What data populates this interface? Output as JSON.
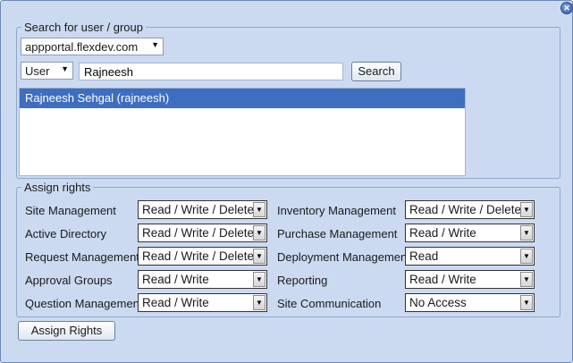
{
  "search": {
    "legend": "Search for user / group",
    "domain": "appportal.flexdev.com",
    "type": "User",
    "query": "Rajneesh",
    "search_button": "Search",
    "results": [
      "Rajneesh Sehgal (rajneesh)"
    ]
  },
  "rights": {
    "legend": "Assign rights",
    "left": [
      {
        "label": "Site Management",
        "value": "Read / Write / Delete"
      },
      {
        "label": "Active Directory",
        "value": "Read / Write / Delete"
      },
      {
        "label": "Request Management",
        "value": "Read / Write / Delete"
      },
      {
        "label": "Approval Groups",
        "value": "Read / Write"
      },
      {
        "label": "Question Management",
        "value": "Read / Write"
      }
    ],
    "right": [
      {
        "label": "Inventory Management",
        "value": "Read / Write / Delete"
      },
      {
        "label": "Purchase Management",
        "value": "Read / Write"
      },
      {
        "label": "Deployment Management",
        "value": "Read"
      },
      {
        "label": "Reporting",
        "value": "Read / Write"
      },
      {
        "label": "Site Communication",
        "value": "No Access"
      }
    ]
  },
  "assign_button": "Assign Rights",
  "icons": {
    "close": "close-icon",
    "dropdown": "chevron-down-icon"
  },
  "colors": {
    "window_bg": "#cbdaf1",
    "selection": "#3d6ec0"
  }
}
